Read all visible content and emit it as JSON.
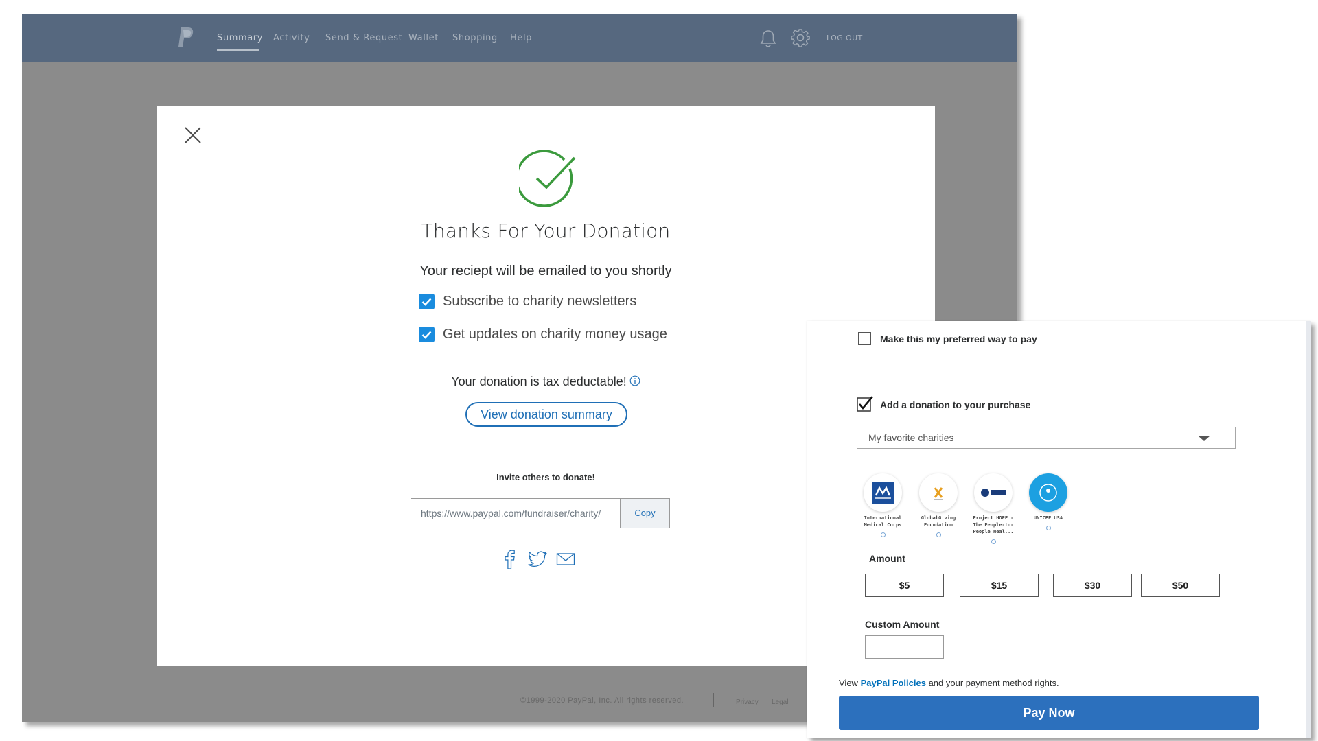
{
  "nav": {
    "items": [
      "Summary",
      "Activity",
      "Send & Request",
      "Wallet",
      "Shopping",
      "Help"
    ],
    "logout": "LOG OUT"
  },
  "footer": {
    "links": [
      "HELP",
      "CONTACT US",
      "SECURITY",
      "FEES",
      "FEEDBACK"
    ],
    "copyright": "©1999-2020 PayPal, Inc. All rights reserved.",
    "privacy": "Privacy",
    "legal": "Legal"
  },
  "modal": {
    "title": "Thanks For Your Donation",
    "receipt": "Your reciept will be emailed to you shortly",
    "options": [
      "Subscribe to charity newsletters",
      "Get updates on charity money usage"
    ],
    "tax": "Your donation is tax deductable!",
    "view_summary": "View donation summary",
    "invite": "Invite others to donate!",
    "share_url": "https://www.paypal.com/fundraiser/charity/",
    "copy": "Copy"
  },
  "panel": {
    "preferred": "Make this my preferred way to pay",
    "add_donation": "Add a donation to your purchase",
    "select_value": "My favorite charities",
    "charities": [
      {
        "name": "International Medical Corps"
      },
      {
        "name": "GlobalGiving Foundation"
      },
      {
        "name": "Project HOPE - The People-to-People Heal..."
      },
      {
        "name": "UNICEF USA"
      }
    ],
    "amount_label": "Amount",
    "amounts": [
      "$5",
      "$15",
      "$30",
      "$50"
    ],
    "custom_label": "Custom Amount",
    "policies_prefix": "View ",
    "policies_link": "PayPal Policies",
    "policies_suffix": " and your payment method rights.",
    "pay_now": "Pay Now"
  },
  "colors": {
    "topbar": "#56687f",
    "brand_blue": "#1f6fb6",
    "check_green": "#3b9a3d",
    "checkbox_blue": "#1a8cde",
    "pay_button": "#2c70bd"
  }
}
